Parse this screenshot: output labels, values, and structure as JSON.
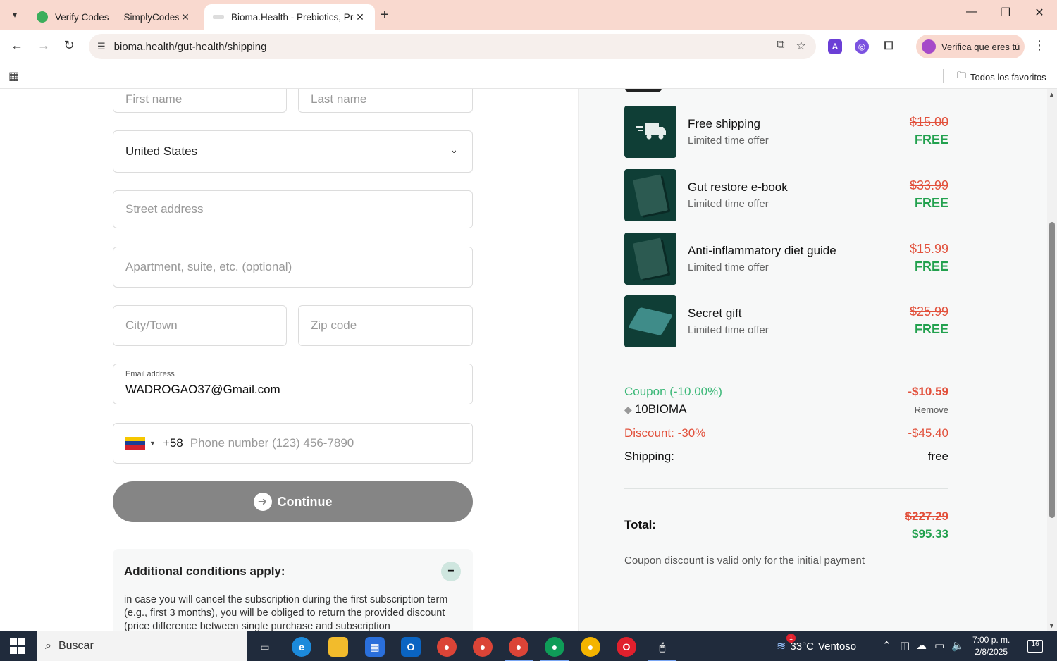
{
  "browser": {
    "tabs": [
      {
        "title": "Verify Codes — SimplyCodes",
        "active": false
      },
      {
        "title": "Bioma.Health - Prebiotics, Prob",
        "active": true
      }
    ],
    "url": "bioma.health/gut-health/shipping",
    "profile_label": "Verifica que eres tú",
    "bookmarks_folder": "Todos los favoritos"
  },
  "form": {
    "first_name_placeholder": "First name",
    "last_name_placeholder": "Last name",
    "country": "United States",
    "street_placeholder": "Street address",
    "apartment_placeholder": "Apartment, suite, etc. (optional)",
    "city_placeholder": "City/Town",
    "zip_placeholder": "Zip code",
    "email_label": "Email address",
    "email_value": "WADROGAO37@Gmail.com",
    "phone_code": "+58",
    "phone_placeholder": "Phone number (123) 456-7890",
    "continue_label": "Continue"
  },
  "conditions": {
    "title": "Additional conditions apply:",
    "text": "in case you will cancel the subscription during the first subscription term (e.g., first 3 months), you will be obliged to return the provided discount (price difference between single purchase and subscription"
  },
  "items": [
    {
      "name": "Free shipping",
      "sub": "Limited time offer",
      "old_price": "$15.00",
      "price": "FREE",
      "icon": "truck-icon"
    },
    {
      "name": "Gut restore e-book",
      "sub": "Limited time offer",
      "old_price": "$33.99",
      "price": "FREE",
      "icon": "ebook-icon"
    },
    {
      "name": "Anti-inflammatory diet guide",
      "sub": "Limited time offer",
      "old_price": "$15.99",
      "price": "FREE",
      "icon": "guide-icon"
    },
    {
      "name": "Secret gift",
      "sub": "Limited time offer",
      "old_price": "$25.99",
      "price": "FREE",
      "icon": "gift-icon"
    }
  ],
  "summary": {
    "coupon_label": "Coupon (-10.00%)",
    "coupon_amount": "-$10.59",
    "coupon_code": "10BIOMA",
    "remove_label": "Remove",
    "discount_label": "Discount: -30%",
    "discount_amount": "-$45.40",
    "shipping_label": "Shipping:",
    "shipping_value": "free",
    "total_label": "Total:",
    "total_old": "$227.29",
    "total_new": "$95.33",
    "note": "Coupon discount is valid only for the initial payment"
  },
  "taskbar": {
    "search_label": "Buscar",
    "weather_temp": "33°C",
    "weather_desc": "Ventoso",
    "weather_badge": "1",
    "time": "7:00 p. m.",
    "date": "2/8/2025",
    "notifications": "16"
  },
  "colors": {
    "accent_red": "#e2503b",
    "accent_green": "#22a14e",
    "coupon_green": "#3cb878",
    "thumb_bg": "#0f3e36",
    "tab_strip": "#f9d9cf"
  }
}
